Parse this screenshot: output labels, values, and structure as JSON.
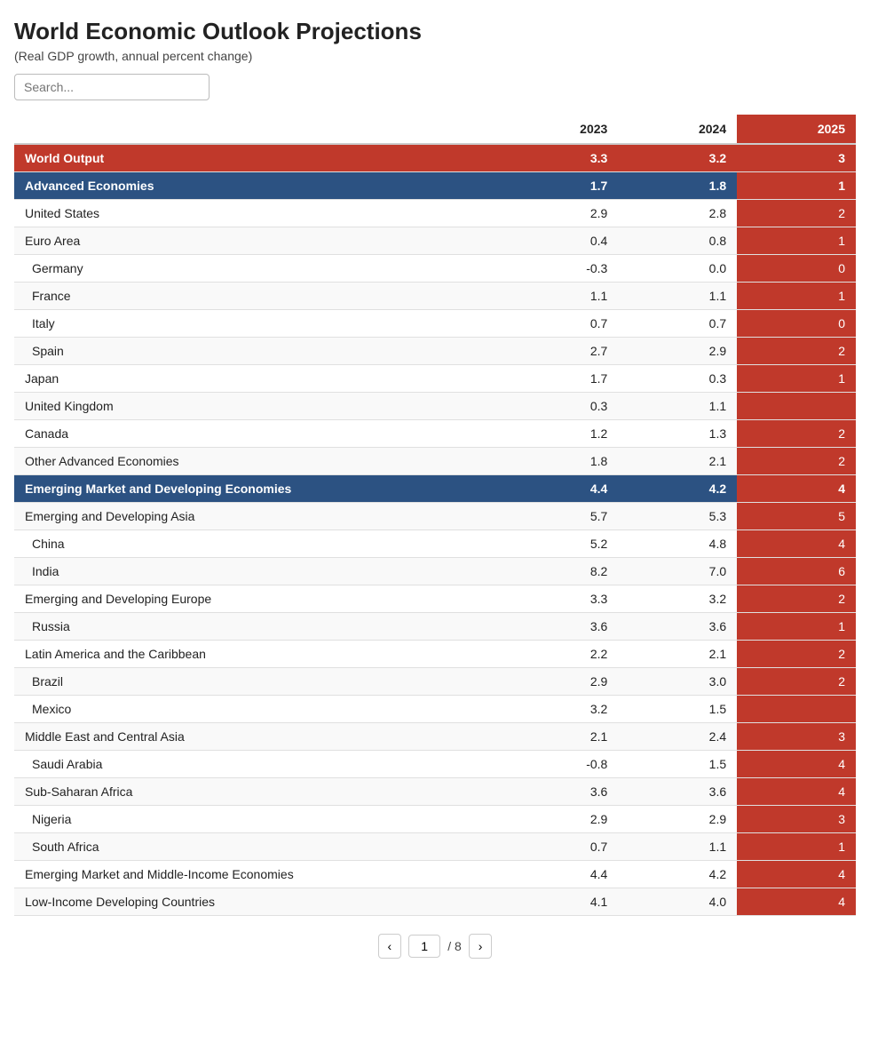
{
  "title": "World Economic Outlook Projections",
  "subtitle": "(Real GDP growth, annual percent change)",
  "search": {
    "placeholder": "Search..."
  },
  "columns": [
    "2023",
    "2024",
    "2025"
  ],
  "rows": [
    {
      "label": "World Output",
      "type": "header",
      "indent": 0,
      "values": [
        "3.3",
        "3.2",
        "3"
      ]
    },
    {
      "label": "Advanced Economies",
      "type": "subheader",
      "indent": 0,
      "values": [
        "1.7",
        "1.8",
        "1"
      ]
    },
    {
      "label": "United States",
      "type": "data",
      "indent": 0,
      "values": [
        "2.9",
        "2.8",
        "2"
      ]
    },
    {
      "label": "Euro Area",
      "type": "data",
      "indent": 0,
      "values": [
        "0.4",
        "0.8",
        "1"
      ]
    },
    {
      "label": "Germany",
      "type": "data",
      "indent": 1,
      "values": [
        "-0.3",
        "0.0",
        "0"
      ]
    },
    {
      "label": "France",
      "type": "data",
      "indent": 1,
      "values": [
        "1.1",
        "1.1",
        "1"
      ]
    },
    {
      "label": "Italy",
      "type": "data",
      "indent": 1,
      "values": [
        "0.7",
        "0.7",
        "0"
      ]
    },
    {
      "label": "Spain",
      "type": "data",
      "indent": 1,
      "values": [
        "2.7",
        "2.9",
        "2"
      ]
    },
    {
      "label": "Japan",
      "type": "data",
      "indent": 0,
      "values": [
        "1.7",
        "0.3",
        "1"
      ]
    },
    {
      "label": "United Kingdom",
      "type": "data",
      "indent": 0,
      "values": [
        "0.3",
        "1.1",
        ""
      ]
    },
    {
      "label": "Canada",
      "type": "data",
      "indent": 0,
      "values": [
        "1.2",
        "1.3",
        "2"
      ]
    },
    {
      "label": "Other Advanced Economies",
      "type": "data",
      "indent": 0,
      "values": [
        "1.8",
        "2.1",
        "2"
      ]
    },
    {
      "label": "Emerging Market and Developing Economies",
      "type": "subheader",
      "indent": 0,
      "values": [
        "4.4",
        "4.2",
        "4"
      ]
    },
    {
      "label": "Emerging and Developing Asia",
      "type": "data",
      "indent": 0,
      "values": [
        "5.7",
        "5.3",
        "5"
      ]
    },
    {
      "label": "China",
      "type": "data",
      "indent": 1,
      "values": [
        "5.2",
        "4.8",
        "4"
      ]
    },
    {
      "label": "India",
      "type": "data",
      "indent": 1,
      "values": [
        "8.2",
        "7.0",
        "6"
      ]
    },
    {
      "label": "Emerging and Developing Europe",
      "type": "data",
      "indent": 0,
      "values": [
        "3.3",
        "3.2",
        "2"
      ]
    },
    {
      "label": "Russia",
      "type": "data",
      "indent": 1,
      "values": [
        "3.6",
        "3.6",
        "1"
      ]
    },
    {
      "label": "Latin America and the Caribbean",
      "type": "data",
      "indent": 0,
      "values": [
        "2.2",
        "2.1",
        "2"
      ]
    },
    {
      "label": "Brazil",
      "type": "data",
      "indent": 1,
      "values": [
        "2.9",
        "3.0",
        "2"
      ]
    },
    {
      "label": "Mexico",
      "type": "data",
      "indent": 1,
      "values": [
        "3.2",
        "1.5",
        ""
      ]
    },
    {
      "label": "Middle East and Central Asia",
      "type": "data",
      "indent": 0,
      "values": [
        "2.1",
        "2.4",
        "3"
      ]
    },
    {
      "label": "Saudi Arabia",
      "type": "data",
      "indent": 1,
      "values": [
        "-0.8",
        "1.5",
        "4"
      ]
    },
    {
      "label": "Sub-Saharan Africa",
      "type": "data",
      "indent": 0,
      "values": [
        "3.6",
        "3.6",
        "4"
      ]
    },
    {
      "label": "Nigeria",
      "type": "data",
      "indent": 1,
      "values": [
        "2.9",
        "2.9",
        "3"
      ]
    },
    {
      "label": "South Africa",
      "type": "data",
      "indent": 1,
      "values": [
        "0.7",
        "1.1",
        "1"
      ]
    },
    {
      "label": "Emerging Market and Middle-Income Economies",
      "type": "data",
      "indent": 0,
      "values": [
        "4.4",
        "4.2",
        "4"
      ]
    },
    {
      "label": "Low-Income Developing Countries",
      "type": "data",
      "indent": 0,
      "values": [
        "4.1",
        "4.0",
        "4"
      ]
    }
  ],
  "pagination": {
    "current_page": "1",
    "total_pages": "8",
    "prev_label": "‹",
    "next_label": "›",
    "separator": "/"
  }
}
